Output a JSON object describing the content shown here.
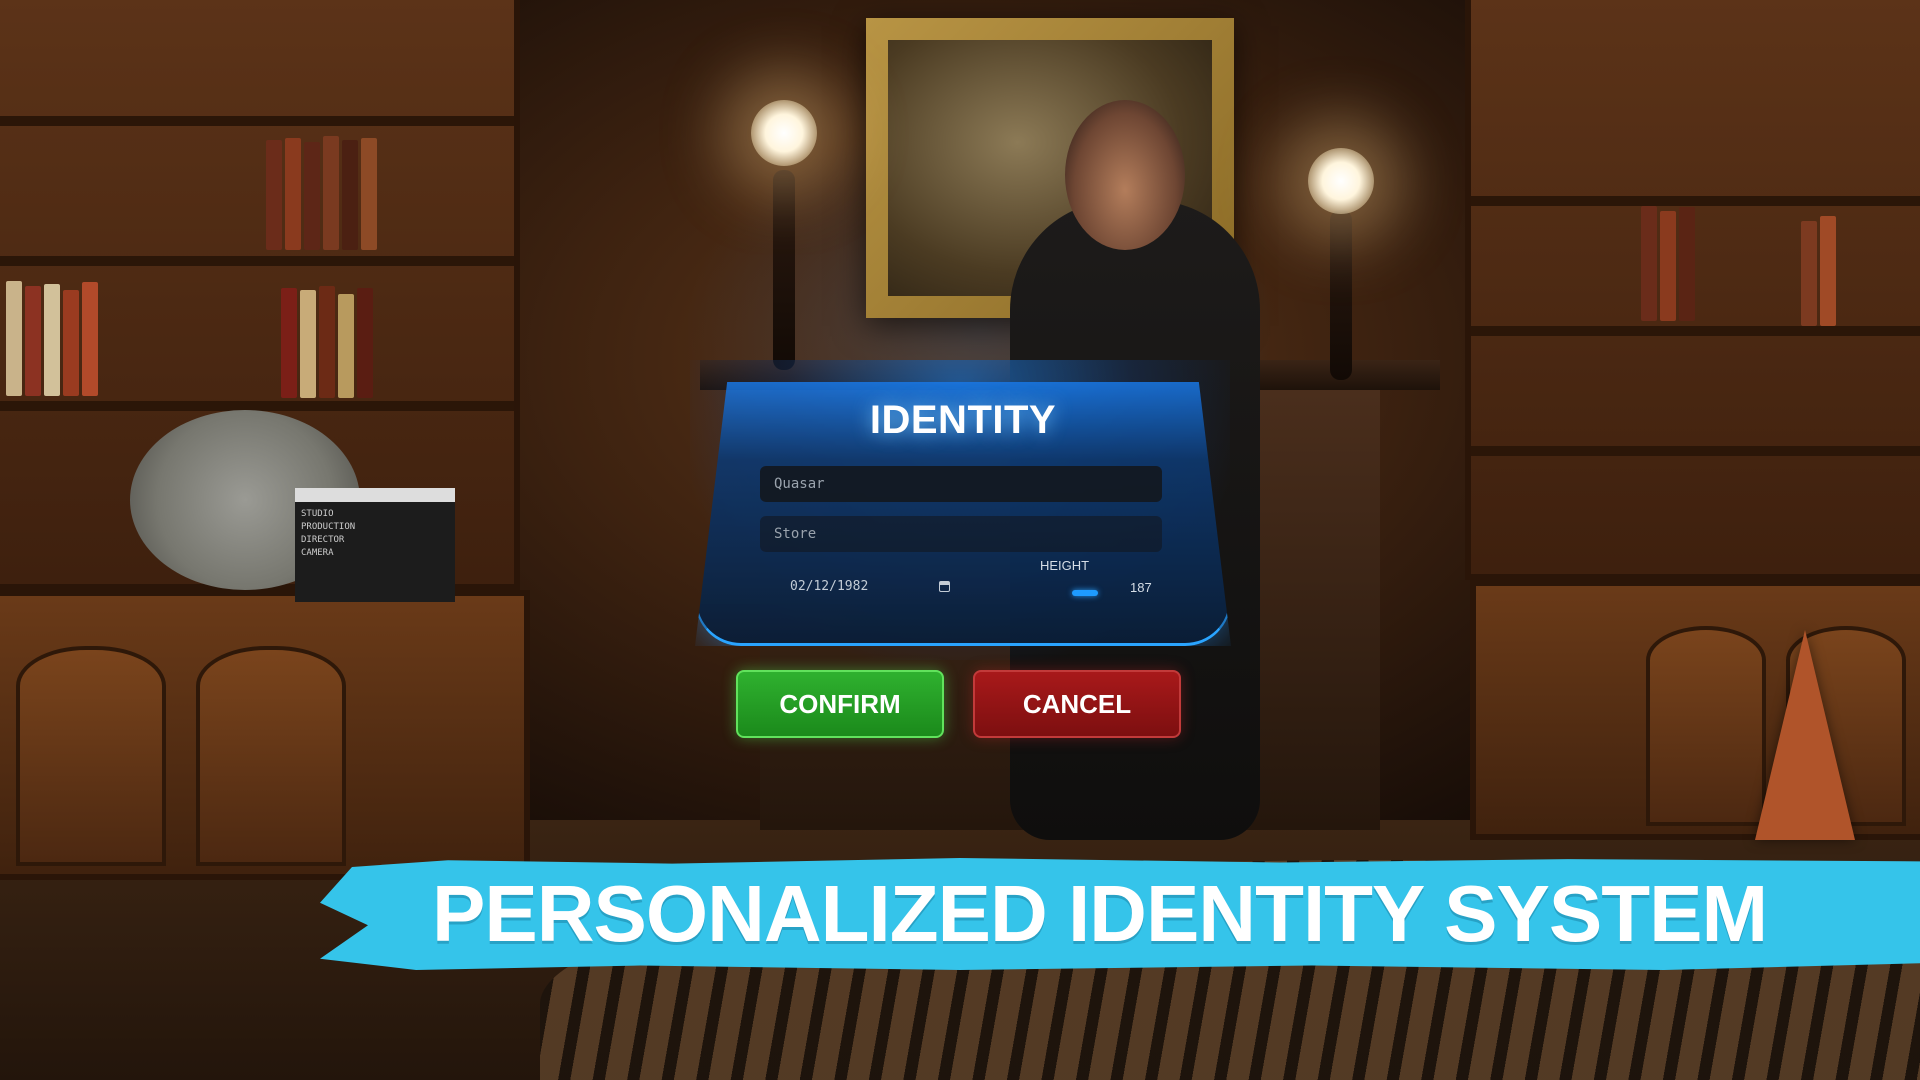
{
  "dialog": {
    "title": "IDENTITY",
    "first_name_value": "Quasar",
    "last_name_value": "Store",
    "date_of_birth": "02/12/1982",
    "height_label": "HEIGHT",
    "height_value": "187",
    "height_level_fraction": 0.5,
    "confirm_label": "CONFIRM",
    "cancel_label": "CANCEL"
  },
  "banner": {
    "text": "PERSONALIZED IDENTITY SYSTEM"
  },
  "icons": {
    "date_picker": "calendar-icon"
  },
  "colors": {
    "accent_blue": "#1e9bff",
    "confirm_green": "#2fb12f",
    "cancel_red": "#a8191a",
    "banner_cyan": "#35c4ea"
  }
}
